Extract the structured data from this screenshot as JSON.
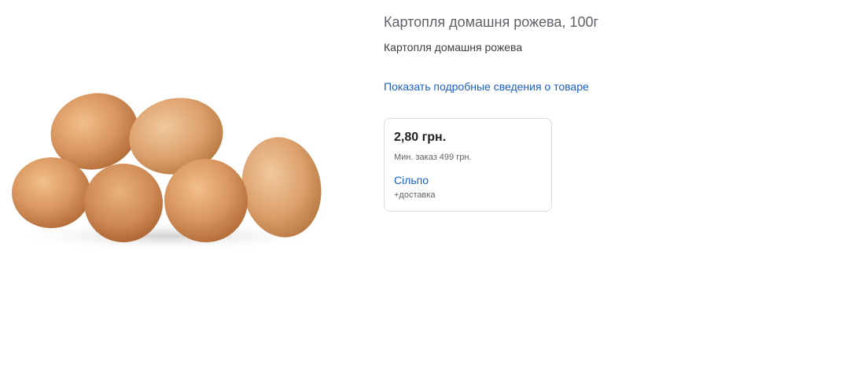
{
  "product": {
    "title": "Картопля домашня рожева, 100г",
    "subtitle": "Картопля домашня рожева",
    "details_link": "Показать подробные сведения о товаре"
  },
  "offer": {
    "price": "2,80 грн.",
    "min_order": "Мин. заказ 499 грн.",
    "seller": "Сільпо",
    "delivery": "+доставка"
  },
  "colors": {
    "link": "#1a5fc9",
    "potato_light": "#e3a56a",
    "potato_dark": "#c27a45"
  }
}
